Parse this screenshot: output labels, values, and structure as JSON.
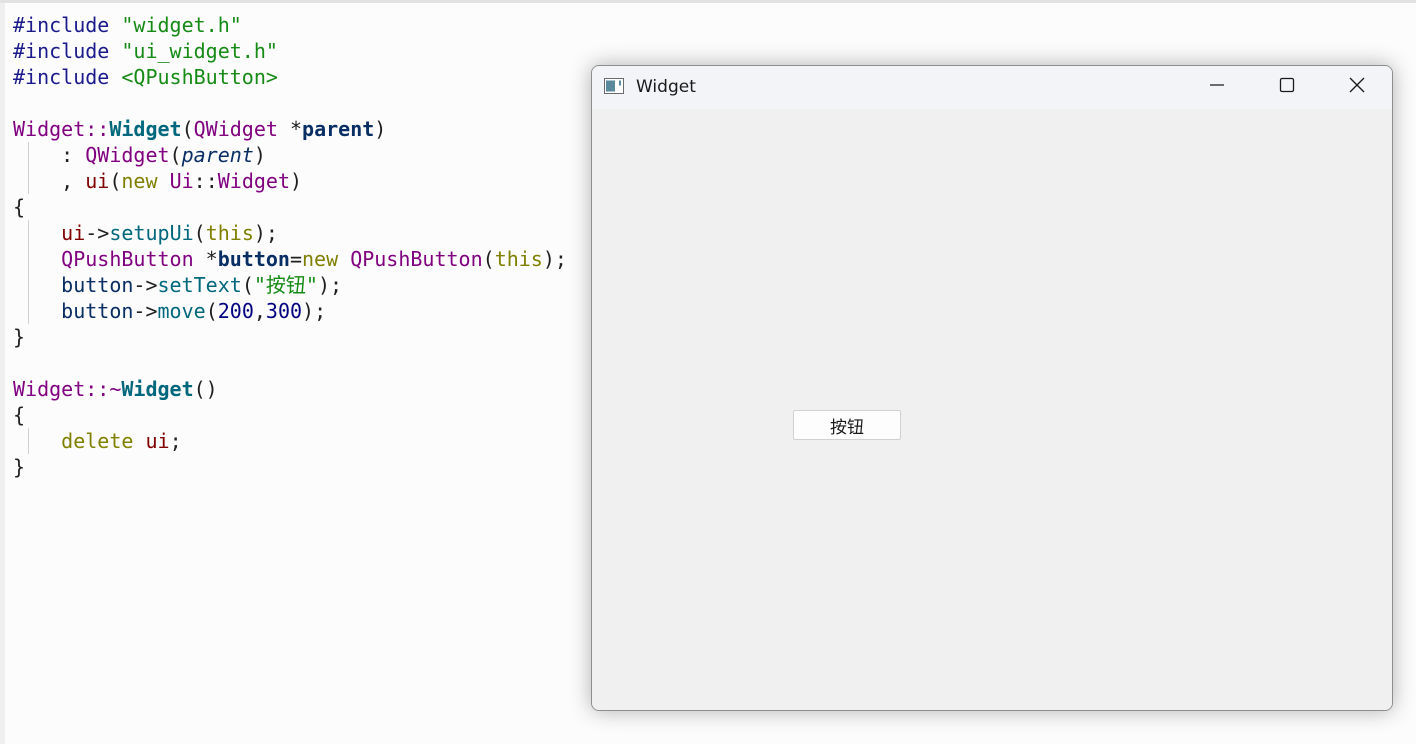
{
  "editor": {
    "include1_directive": "#include",
    "include1_file": "\"widget.h\"",
    "include2_directive": "#include",
    "include2_file": "\"ui_widget.h\"",
    "include3_directive": "#include",
    "include3_file": "<QPushButton>",
    "ctor_class": "Widget",
    "ctor_sep": "::",
    "ctor_name": "Widget",
    "ctor_open": "(",
    "ctor_param_type": "QWidget",
    "ctor_param_ptr": " *",
    "ctor_param_name": "parent",
    "ctor_close": ")",
    "init1_colon": "    : ",
    "init1_class": "QWidget",
    "init1_open": "(",
    "init1_arg": "parent",
    "init1_close": ")",
    "init2_comma": "    , ",
    "init2_member": "ui",
    "init2_open": "(",
    "init2_new": "new",
    "init2_ns": "Ui",
    "init2_sep": "::",
    "init2_class": "Widget",
    "init2_close": ")",
    "brace_open_1": "{",
    "setup_member": "ui",
    "setup_arrow": "->",
    "setup_call": "setupUi",
    "setup_open": "(",
    "setup_this": "this",
    "setup_close": ");",
    "decl_type": "QPushButton",
    "decl_ptr": " *",
    "decl_var": "button",
    "decl_eq": "=",
    "decl_new": "new",
    "decl_class": "QPushButton",
    "decl_open": "(",
    "decl_this": "this",
    "decl_close": ");",
    "settext_var": "button",
    "settext_arrow": "->",
    "settext_call": "setText",
    "settext_open": "(",
    "settext_str": "\"按钮\"",
    "settext_close": ");",
    "move_var": "button",
    "move_arrow": "->",
    "move_call": "move",
    "move_open": "(",
    "move_x": "200",
    "move_comma": ",",
    "move_y": "300",
    "move_close": ");",
    "brace_close_1": "}",
    "dtor_class": "Widget",
    "dtor_sep": "::~",
    "dtor_name": "Widget",
    "dtor_parens": "()",
    "brace_open_2": "{",
    "delete_kw": "delete",
    "delete_member": "ui",
    "delete_semi": ";",
    "brace_close_2": "}"
  },
  "window": {
    "title": "Widget",
    "app_icon": "qt-window-icon",
    "minimize_icon": "minimize-icon",
    "maximize_icon": "maximize-icon",
    "close_icon": "close-icon",
    "button_label": "按钮"
  }
}
